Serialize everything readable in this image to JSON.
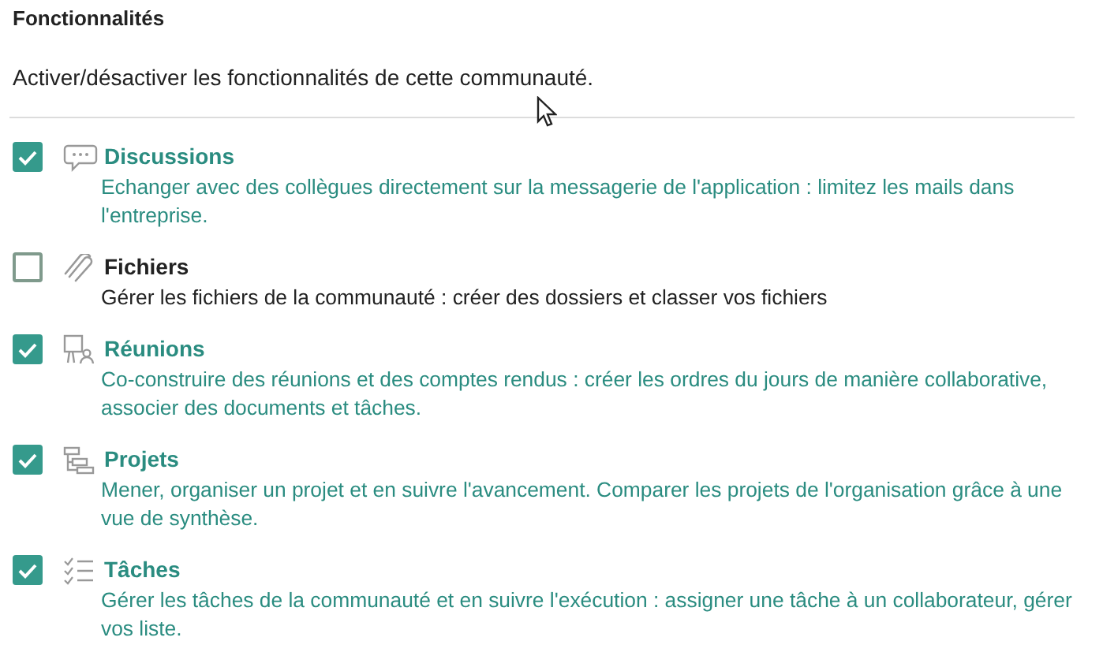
{
  "heading": "Fonctionnalités",
  "subtitle": "Activer/désactiver les fonctionnalités de cette communauté.",
  "features": [
    {
      "kind": "discussions",
      "title": "Discussions",
      "description": "Echanger avec des collègues directement sur la messagerie de l'application : limitez les mails dans l'entreprise.",
      "checked": true
    },
    {
      "kind": "fichiers",
      "title": "Fichiers",
      "description": "Gérer les fichiers de la communauté : créer des dossiers et classer vos fichiers",
      "checked": false
    },
    {
      "kind": "reunions",
      "title": "Réunions",
      "description": "Co-construire des réunions et des comptes rendus : créer les ordres du jours de manière collaborative, associer des documents et tâches.",
      "checked": true
    },
    {
      "kind": "projets",
      "title": "Projets",
      "description": "Mener, organiser un projet et en suivre l'avancement. Comparer les projets de l'organisation grâce à une vue de synthèse.",
      "checked": true
    },
    {
      "kind": "taches",
      "title": "Tâches",
      "description": "Gérer les tâches de la communauté et en suivre l'exécution : assigner une tâche à un collaborateur, gérer vos liste.",
      "checked": true
    }
  ]
}
